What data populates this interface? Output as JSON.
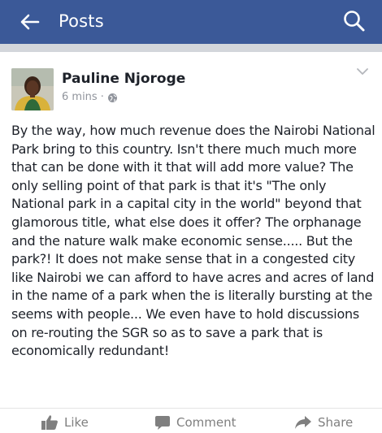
{
  "header": {
    "title": "Posts",
    "back_icon": "arrow-left-icon",
    "search_icon": "search-icon",
    "background_color": "#3b5998"
  },
  "post": {
    "author": "Pauline Njoroge",
    "time": "6 mins",
    "separator": "·",
    "audience_icon": "globe-icon",
    "menu_icon": "chevron-down-icon",
    "text": "By the way, how much revenue does the Nairobi National Park bring to this country. Isn't there much much more that can be done with it that will add more value? The only selling point of that park is that it's \"The only National park in a capital city in the world\" beyond that glamorous title, what else does it offer? The orphanage and the nature walk make economic sense..... But the park?! It does not make sense that in a congested city like Nairobi we can afford to have acres and acres of land in the name of a park when the is literally bursting at the seems with people... We even have to hold discussions on re-routing the SGR so as to save a park that is economically redundant!"
  },
  "actions": {
    "like": "Like",
    "comment": "Comment",
    "share": "Share",
    "like_icon": "thumbs-up-icon",
    "comment_icon": "speech-bubble-icon",
    "share_icon": "share-arrow-icon"
  }
}
